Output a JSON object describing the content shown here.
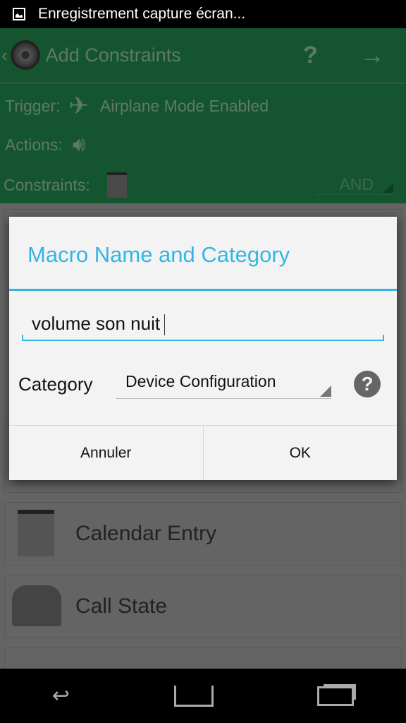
{
  "status_bar": {
    "notification": "Enregistrement capture écran...",
    "icon": "image-icon"
  },
  "action_bar": {
    "back": "‹",
    "title": "Add Constraints",
    "help": "?",
    "next": "→"
  },
  "summary": {
    "trigger_label": "Trigger:",
    "trigger_value": "Airplane Mode Enabled",
    "actions_label": "Actions:",
    "constraints_label": "Constraints:",
    "logic": "AND"
  },
  "list": [
    {
      "label": "Calendar Entry",
      "icon": "calendar-icon"
    },
    {
      "label": "Call State",
      "icon": "telephone-icon"
    }
  ],
  "dialog": {
    "title": "Macro Name and Category",
    "name_value": "volume son nuit",
    "category_label": "Category",
    "category_value": "Device Configuration",
    "help": "?",
    "cancel": "Annuler",
    "ok": "OK"
  },
  "colors": {
    "accent": "#33b5e5",
    "header": "#145530"
  }
}
